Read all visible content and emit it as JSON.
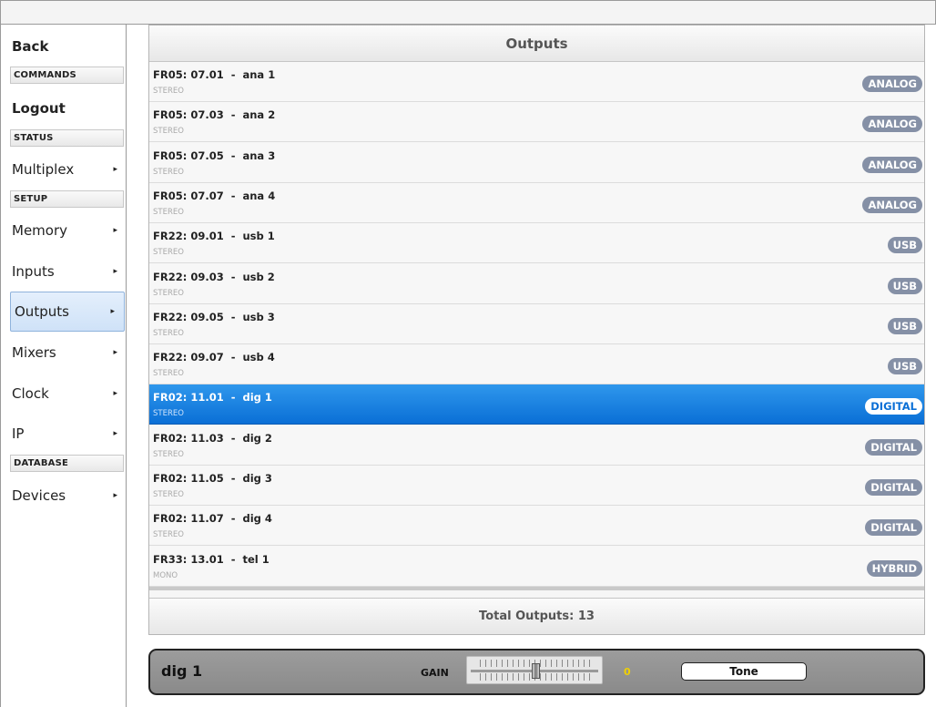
{
  "sidebar": {
    "back_label": "Back",
    "sections": {
      "commands": "COMMANDS",
      "status": "STATUS",
      "setup": "SETUP",
      "database": "DATABASE"
    },
    "logout_label": "Logout",
    "items": {
      "multiplex": "Multiplex",
      "memory": "Memory",
      "inputs": "Inputs",
      "outputs": "Outputs",
      "mixers": "Mixers",
      "clock": "Clock",
      "ip": "IP",
      "devices": "Devices"
    },
    "active_item": "Outputs",
    "arrow_glyph": "▸"
  },
  "panel": {
    "title": "Outputs",
    "footer": "Total Outputs: 13",
    "rows": [
      {
        "name": "FR05: 07.01  -  ana 1",
        "type": "STEREO",
        "badge": "ANALOG"
      },
      {
        "name": "FR05: 07.03  -  ana 2",
        "type": "STEREO",
        "badge": "ANALOG"
      },
      {
        "name": "FR05: 07.05  -  ana 3",
        "type": "STEREO",
        "badge": "ANALOG"
      },
      {
        "name": "FR05: 07.07  -  ana 4",
        "type": "STEREO",
        "badge": "ANALOG"
      },
      {
        "name": "FR22: 09.01  -  usb 1",
        "type": "STEREO",
        "badge": "USB"
      },
      {
        "name": "FR22: 09.03  -  usb 2",
        "type": "STEREO",
        "badge": "USB"
      },
      {
        "name": "FR22: 09.05  -  usb 3",
        "type": "STEREO",
        "badge": "USB"
      },
      {
        "name": "FR22: 09.07  -  usb 4",
        "type": "STEREO",
        "badge": "USB"
      },
      {
        "name": "FR02: 11.01  -  dig 1",
        "type": "STEREO",
        "badge": "DIGITAL",
        "selected": true
      },
      {
        "name": "FR02: 11.03  -  dig 2",
        "type": "STEREO",
        "badge": "DIGITAL"
      },
      {
        "name": "FR02: 11.05  -  dig 3",
        "type": "STEREO",
        "badge": "DIGITAL"
      },
      {
        "name": "FR02: 11.07  -  dig 4",
        "type": "STEREO",
        "badge": "DIGITAL"
      },
      {
        "name": "FR33: 13.01  -  tel 1",
        "type": "MONO",
        "badge": "HYBRID"
      }
    ]
  },
  "control": {
    "channel_name": "dig 1",
    "gain_label": "GAIN",
    "gain_value": "0",
    "gain_fader_level": 0.5,
    "tone_label": "Tone"
  },
  "colors": {
    "selection": "#0a6fd6",
    "badge": "#8590a6",
    "gain_value": "#f0d000"
  }
}
